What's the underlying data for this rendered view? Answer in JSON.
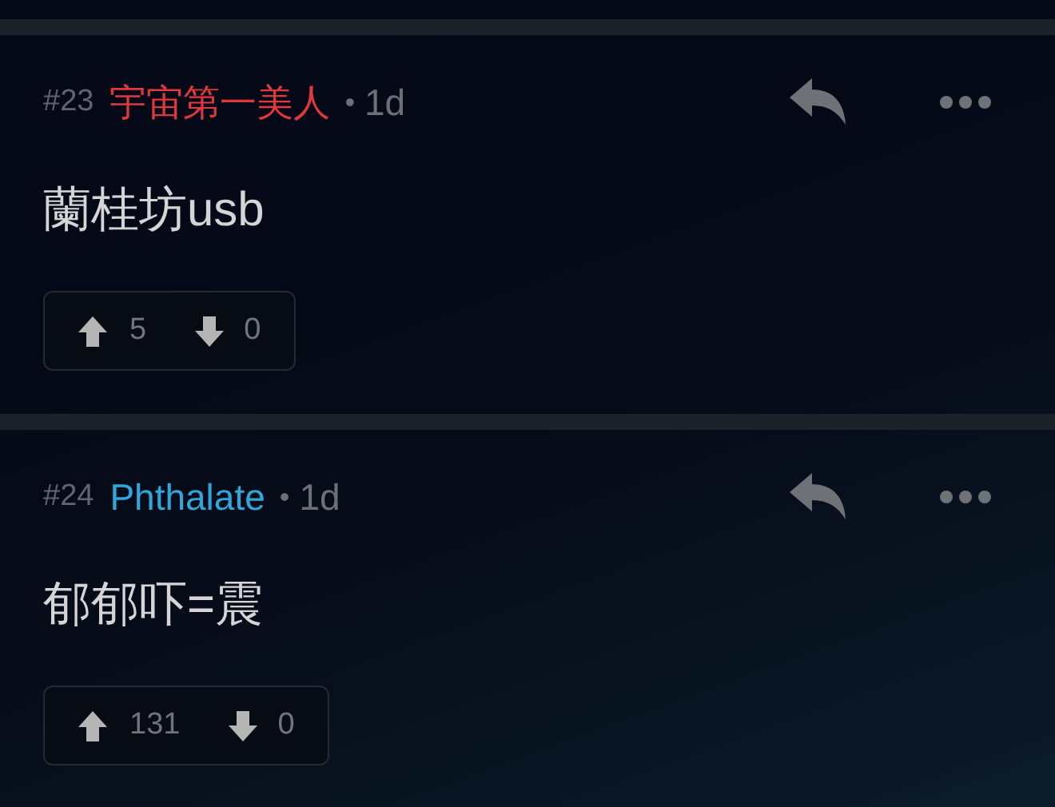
{
  "comments": [
    {
      "number": "#23",
      "author": "宇宙第一美人",
      "color": "#e0383e",
      "separator": "•",
      "time": "1d",
      "body": "蘭桂坊usb",
      "upvotes": "5",
      "downvotes": "0"
    },
    {
      "number": "#24",
      "author": "Phthalate",
      "color": "#2ea7dc",
      "separator": "•",
      "time": "1d",
      "body": "郁郁吓=震",
      "upvotes": "131",
      "downvotes": "0"
    }
  ]
}
